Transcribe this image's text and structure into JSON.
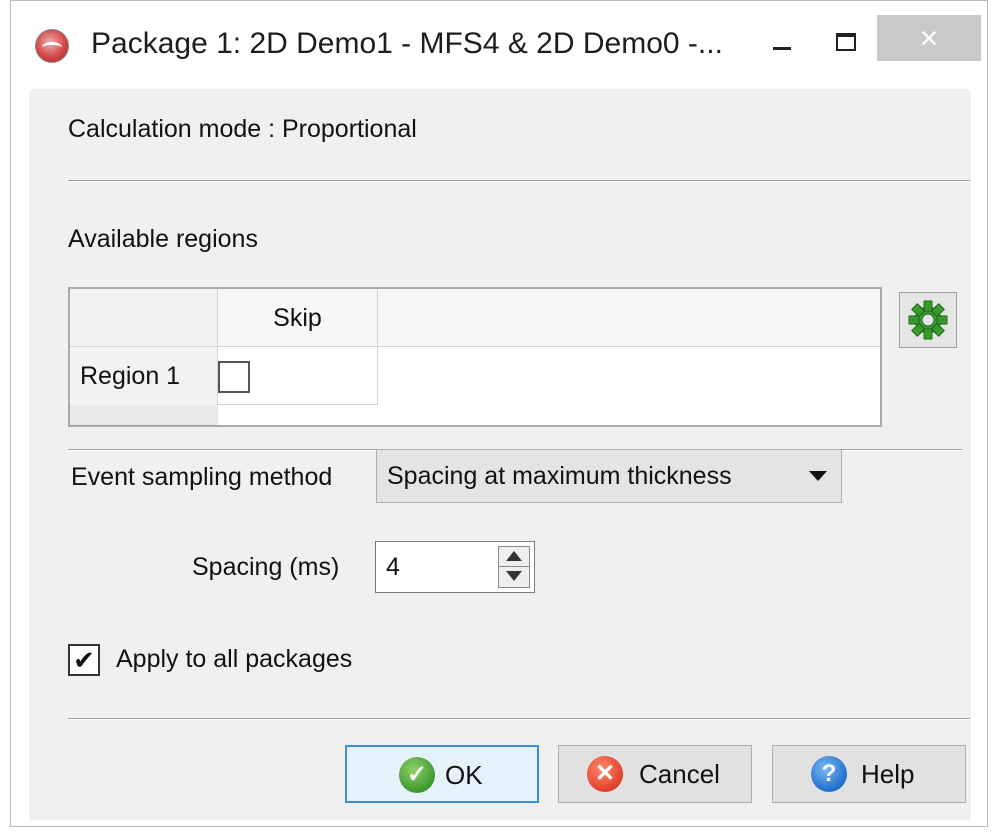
{
  "window": {
    "title": "Package 1: 2D Demo1 - MFS4 & 2D Demo0 -...",
    "close_glyph": "×",
    "minimize_icon": "minimize-icon",
    "maximize_icon": "maximize-icon"
  },
  "calculation_mode": "Calculation mode : Proportional",
  "regions": {
    "heading": "Available regions",
    "columns": [
      "",
      "Skip"
    ],
    "rows": [
      {
        "name": "Region 1",
        "skip": false
      }
    ],
    "settings_icon": "gear-icon"
  },
  "event_sampling": {
    "label": "Event sampling method",
    "selected": "Spacing at maximum thickness"
  },
  "spacing": {
    "label": "Spacing (ms)",
    "value": "4"
  },
  "apply_all": {
    "label": "Apply to all packages",
    "checked": true,
    "check_glyph": "✔"
  },
  "buttons": {
    "ok": "OK",
    "cancel": "Cancel",
    "help": "Help",
    "ok_glyph": "✓",
    "cancel_glyph": "✕",
    "help_glyph": "?"
  }
}
